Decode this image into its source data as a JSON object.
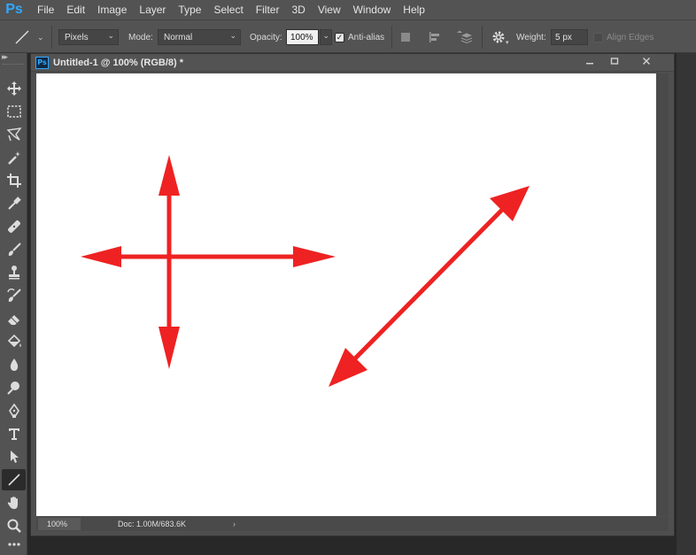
{
  "app": {
    "logo": "Ps"
  },
  "menu": [
    "File",
    "Edit",
    "Image",
    "Layer",
    "Type",
    "Select",
    "Filter",
    "3D",
    "View",
    "Window",
    "Help"
  ],
  "options": {
    "tool_icon": "line-tool-icon",
    "pixels_label": "Pixels",
    "mode_label": "Mode:",
    "mode_value": "Normal",
    "opacity_label": "Opacity:",
    "opacity_value": "100%",
    "antialias_label": "Anti-alias",
    "antialias_checked": true,
    "weight_label": "Weight:",
    "weight_value": "5 px",
    "align_edges_label": "Align Edges",
    "align_edges_checked": false
  },
  "tools": [
    "move-tool-icon",
    "marquee-tool-icon",
    "lasso-tool-icon",
    "magic-wand-tool-icon",
    "crop-tool-icon",
    "eyedropper-tool-icon",
    "healing-brush-tool-icon",
    "brush-tool-icon",
    "clone-stamp-tool-icon",
    "history-brush-tool-icon",
    "eraser-tool-icon",
    "paint-bucket-tool-icon",
    "blur-tool-icon",
    "dodge-tool-icon",
    "pen-tool-icon",
    "type-tool-icon",
    "path-selection-tool-icon",
    "line-tool-icon",
    "hand-tool-icon",
    "zoom-tool-icon",
    "more-tools-icon"
  ],
  "active_tool": "line-tool-icon",
  "document": {
    "title": "Untitled-1 @ 100% (RGB/8) *",
    "ps_badge": "Ps",
    "zoom": "100%",
    "doc_info": "Doc: 1.00M/683.6K",
    "canvas_color": "#ffffff",
    "arrow_color": "#ee2222"
  }
}
